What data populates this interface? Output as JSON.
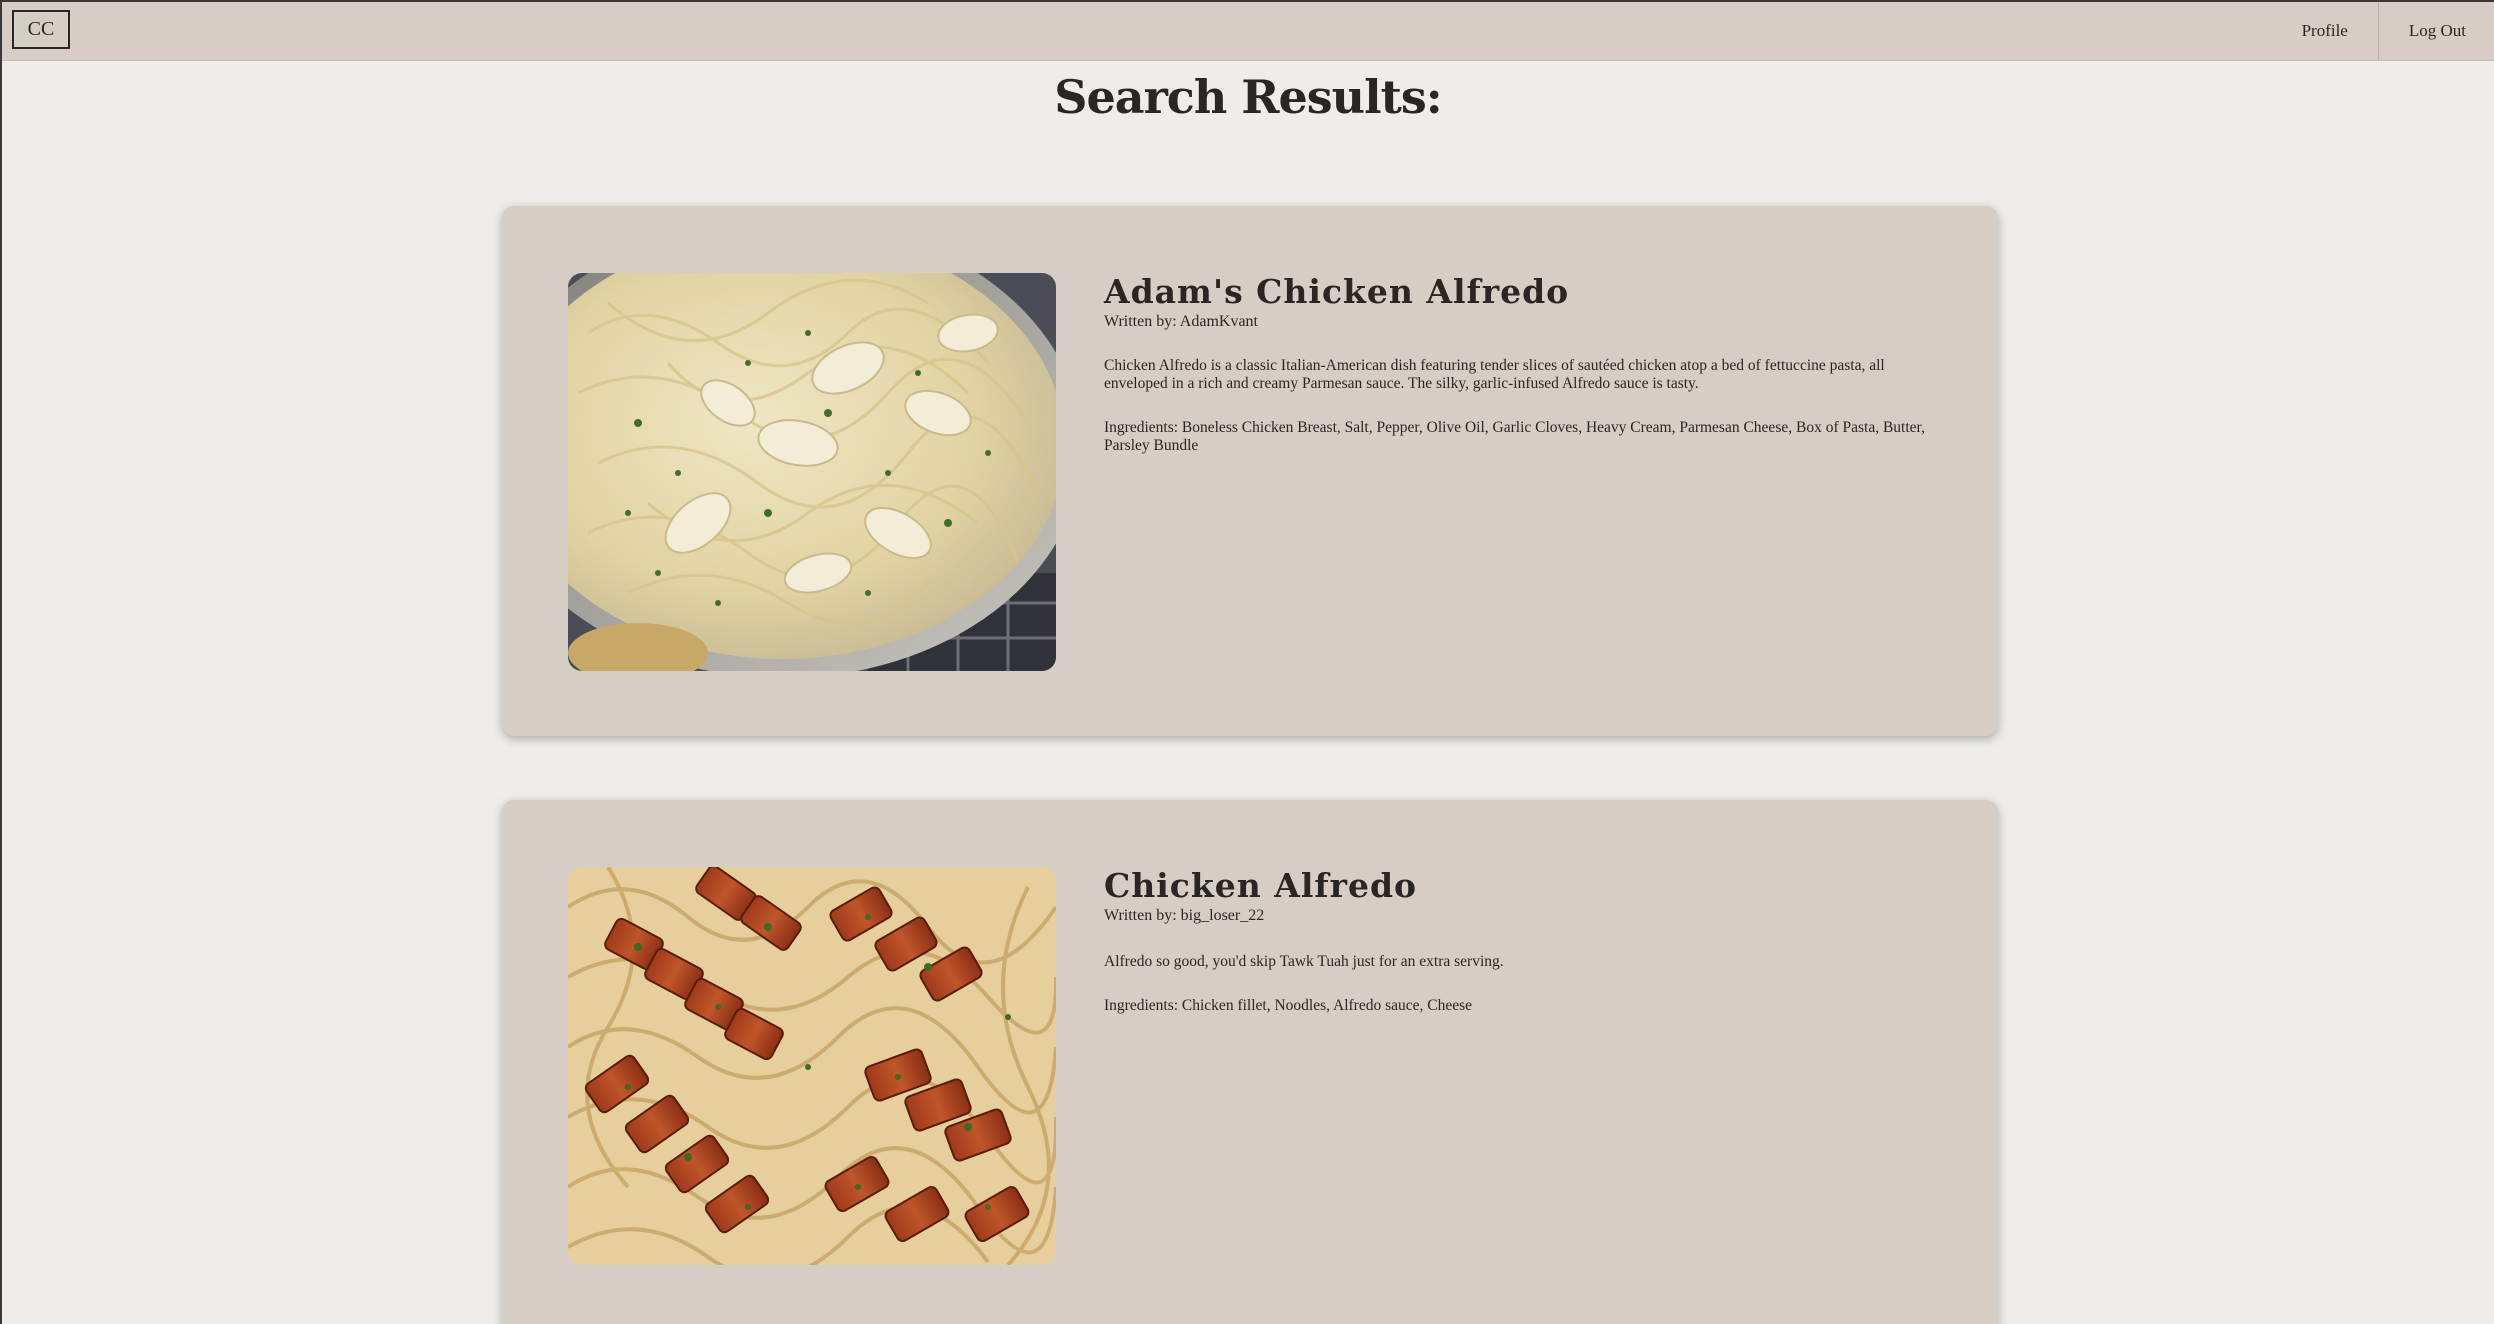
{
  "navbar": {
    "logo": "CC",
    "links": {
      "profile": "Profile",
      "logout": "Log Out"
    }
  },
  "page": {
    "title": "Search Results:"
  },
  "results": [
    {
      "title": "Adam's Chicken Alfredo",
      "author": "Written by: AdamKvant",
      "description": "Chicken Alfredo is a classic Italian-American dish featuring tender slices of sautéed chicken atop a bed of fettuccine pasta, all enveloped in a rich and creamy Parmesan sauce. The silky, garlic-infused Alfredo sauce is tasty.",
      "ingredients": "Ingredients: Boneless Chicken Breast, Salt, Pepper, Olive Oil, Garlic Cloves, Heavy Cream, Parmesan Cheese, Box of Pasta, Butter, Parsley Bundle"
    },
    {
      "title": "Chicken Alfredo",
      "author": "Written by: big_loser_22",
      "description": "Alfredo so good, you'd skip Tawk Tuah just for an extra serving.",
      "ingredients": "Ingredients: Chicken fillet, Noodles, Alfredo sauce, Cheese"
    }
  ],
  "colors": {
    "background": "#eeede9",
    "navbar": "#d6cdc4",
    "card": "#d6cdc4",
    "text": "#2a2624"
  }
}
